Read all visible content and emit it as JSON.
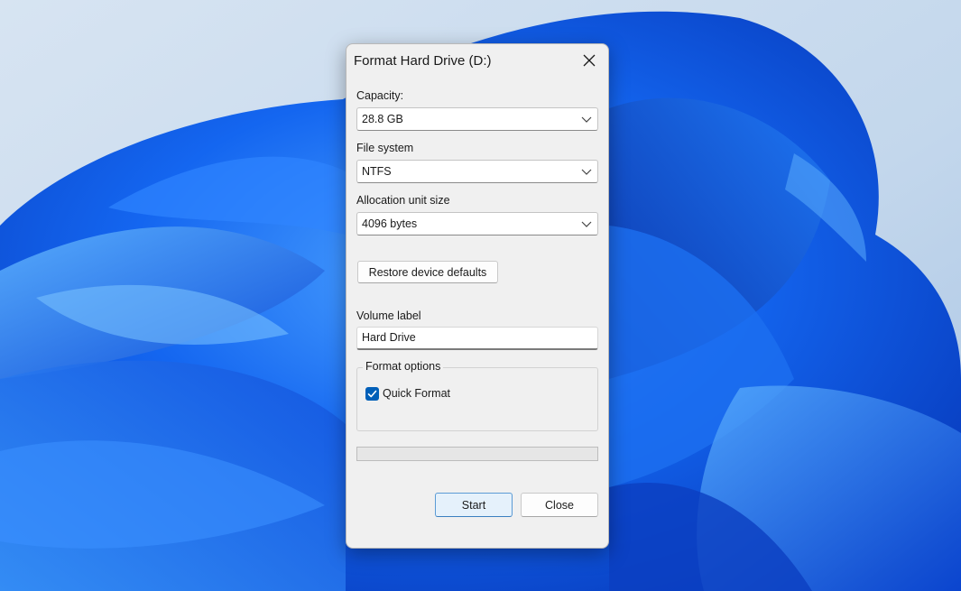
{
  "dialog": {
    "title": "Format Hard Drive (D:)",
    "capacity_label": "Capacity:",
    "capacity_value": "28.8 GB",
    "filesystem_label": "File system",
    "filesystem_value": "NTFS",
    "allocation_label": "Allocation unit size",
    "allocation_value": "4096 bytes",
    "restore_button": "Restore device defaults",
    "volume_label_label": "Volume label",
    "volume_label_value": "Hard Drive",
    "format_options_title": "Format options",
    "quick_format_label": "Quick Format",
    "quick_format_checked": true,
    "progress_fraction": 0,
    "start_button": "Start",
    "close_button": "Close"
  },
  "icons": {
    "close": "close-icon",
    "chevron": "chevron-down-icon",
    "check": "checkmark-icon"
  },
  "colors": {
    "accent": "#005fb8",
    "dialog_bg": "#f0f0f0",
    "wallpaper_blue": "#0a4fd8"
  }
}
